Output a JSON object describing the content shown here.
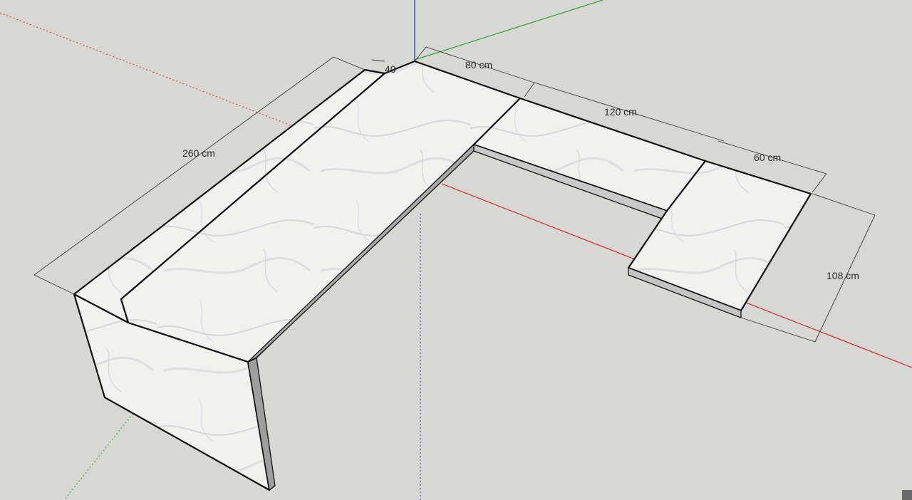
{
  "colors": {
    "background": "#d7d7d3",
    "marble": "#f2f2f1",
    "marble_side": "#e9e9e8",
    "marble_shadow": "#bdbdbd",
    "x_axis": "#d42a2a",
    "y_axis": "#2aa32a",
    "z_axis": "#2a2ad4",
    "edge": "#111111",
    "dimension": "#3a3a3a"
  },
  "dimensions": {
    "long_top": "260 cm",
    "depth_small": "40",
    "top_segment": "80 cm",
    "mid_segment": "120 cm",
    "end_segment": "60 cm",
    "return_depth": "108 cm"
  },
  "icons": {
    "corner_handle": "resize-grip-icon"
  }
}
